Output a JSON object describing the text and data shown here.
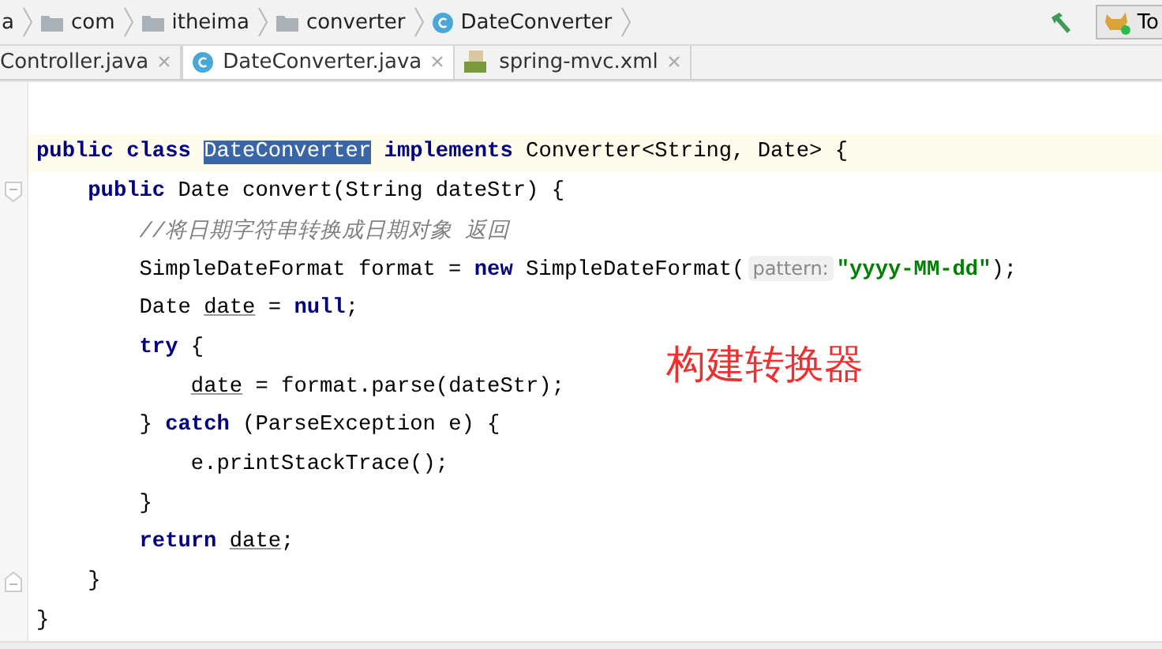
{
  "breadcrumbs": [
    {
      "label": "a",
      "kind": "text"
    },
    {
      "label": "com",
      "kind": "folder"
    },
    {
      "label": "itheima",
      "kind": "folder"
    },
    {
      "label": "converter",
      "kind": "folder"
    },
    {
      "label": "DateConverter",
      "kind": "class"
    }
  ],
  "toolbar": {
    "run_config": "To"
  },
  "tabs": [
    {
      "label": "Controller.java",
      "kind": "class",
      "selected": false
    },
    {
      "label": "DateConverter.java",
      "kind": "class",
      "selected": true
    },
    {
      "label": "spring-mvc.xml",
      "kind": "xml",
      "selected": false
    }
  ],
  "code_lines": [
    {
      "current": true,
      "tokens": [
        {
          "text": "public class ",
          "kind": "keyword"
        },
        {
          "text": "DateConverter",
          "kind": "selected"
        },
        {
          "text": " implements ",
          "kind": "keyword"
        },
        {
          "text": "Converter<String, Date> {",
          "kind": "plain"
        }
      ]
    },
    {
      "current": false,
      "kind": "fold_start",
      "tokens": [
        {
          "text": "    public ",
          "kind": "keyword"
        },
        {
          "text": "Date convert(String dateStr) {",
          "kind": "plain"
        }
      ]
    },
    {
      "current": false,
      "tokens": [
        {
          "text": "        //将日期字符串转换成日期对象 返回",
          "kind": "comment"
        }
      ]
    },
    {
      "current": false,
      "tokens": [
        {
          "text": "        SimpleDateFormat format = ",
          "kind": "plain"
        },
        {
          "text": "new ",
          "kind": "keyword"
        },
        {
          "text": "SimpleDateFormat(",
          "kind": "plain"
        },
        {
          "text": "pattern:",
          "kind": "hint"
        },
        {
          "text": "\"yyyy-MM-dd\"",
          "kind": "string"
        },
        {
          "text": ");",
          "kind": "plain"
        }
      ]
    },
    {
      "current": false,
      "tokens": [
        {
          "text": "        Date ",
          "kind": "plain"
        },
        {
          "text": "date",
          "kind": "variable"
        },
        {
          "text": " = ",
          "kind": "plain"
        },
        {
          "text": "null",
          "kind": "keyword"
        },
        {
          "text": ";",
          "kind": "plain"
        }
      ]
    },
    {
      "current": false,
      "tokens": [
        {
          "text": "        try ",
          "kind": "keyword"
        },
        {
          "text": "{",
          "kind": "plain"
        }
      ]
    },
    {
      "current": false,
      "tokens": [
        {
          "text": "            date",
          "kind": "variable"
        },
        {
          "text": " = format.parse(dateStr);",
          "kind": "plain"
        }
      ]
    },
    {
      "current": false,
      "tokens": [
        {
          "text": "        } ",
          "kind": "plain"
        },
        {
          "text": "catch ",
          "kind": "keyword"
        },
        {
          "text": "(ParseException e) {",
          "kind": "plain"
        }
      ]
    },
    {
      "current": false,
      "tokens": [
        {
          "text": "            e.printStackTrace();",
          "kind": "plain"
        }
      ]
    },
    {
      "current": false,
      "tokens": [
        {
          "text": "        }",
          "kind": "plain"
        }
      ]
    },
    {
      "current": false,
      "tokens": [
        {
          "text": "        return ",
          "kind": "keyword"
        },
        {
          "text": "date",
          "kind": "variable"
        },
        {
          "text": ";",
          "kind": "plain"
        }
      ]
    },
    {
      "current": false,
      "kind": "fold_end",
      "tokens": [
        {
          "text": "    }",
          "kind": "plain"
        }
      ]
    },
    {
      "current": false,
      "tokens": [
        {
          "text": "}",
          "kind": "plain"
        }
      ]
    }
  ],
  "annotation": "构建转换器"
}
